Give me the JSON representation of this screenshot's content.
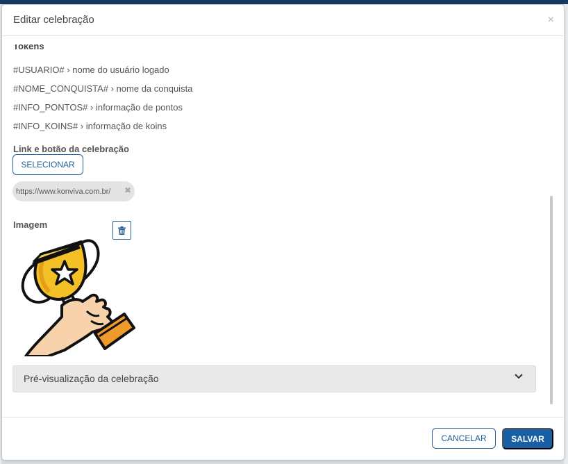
{
  "modal": {
    "title": "Editar celebração",
    "close_icon": "×"
  },
  "tokens": {
    "heading": "Tokens",
    "items": [
      "#USUARIO# › nome do usuário logado",
      "#NOME_CONQUISTA# › nome da conquista",
      "#INFO_PONTOS# › informação de pontos",
      "#INFO_KOINS# › informação de koins"
    ]
  },
  "link": {
    "label": "Link e botão da celebração",
    "select_button": "SELECIONAR",
    "chip_text": "https://www.konviva.com.br/",
    "remove_icon": "✖"
  },
  "image": {
    "label": "Imagem",
    "delete_icon": "trash-icon",
    "picture": "trophy-in-hand-icon"
  },
  "preview": {
    "label": "Pré-visualização da celebração",
    "toggle_icon": "chevron-down-icon"
  },
  "footer": {
    "cancel_label": "CANCELAR",
    "save_label": "SALVAR"
  },
  "colors": {
    "primary": "#1f5f99",
    "primary_fill": "#185fa3",
    "topbar": "#163a5f",
    "preview_bg": "#e9e9e9"
  }
}
